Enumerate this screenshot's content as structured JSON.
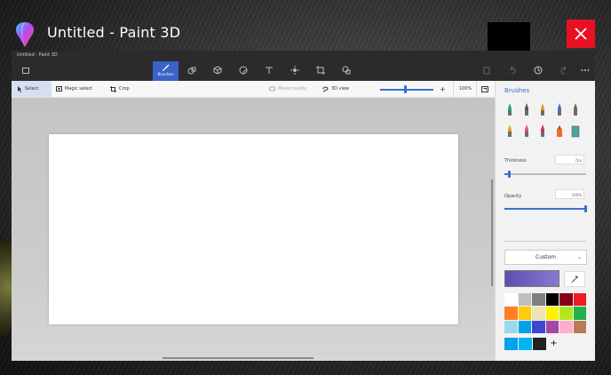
{
  "desktop": {},
  "titlebar": {
    "title": "Untitled - Paint 3D",
    "close_icon": "close-icon"
  },
  "window": {
    "inner_title": "Untitled - Paint 3D"
  },
  "menubar": {
    "active_tab_label": "Brushes",
    "icons": [
      "menu-icon",
      "brushes-icon",
      "2d-shapes-icon",
      "3d-shapes-icon",
      "stickers-icon",
      "text-icon",
      "effects-icon",
      "canvas-icon",
      "3d-library-icon",
      "paste-icon",
      "undo-icon",
      "history-icon",
      "redo-icon",
      "more-icon"
    ]
  },
  "toolbar": {
    "select": "Select",
    "magic_select": "Magic select",
    "crop": "Crop",
    "mixed_reality": "Mixed reality",
    "view_3d": "3D view",
    "zoom_level": "100%"
  },
  "panel": {
    "title": "Brushes",
    "thickness_label": "Thickness",
    "thickness_value": "7px",
    "thickness_fraction": 0.06,
    "opacity_label": "Opacity",
    "opacity_value": "100%",
    "opacity_fraction": 1.0,
    "material": "Custom",
    "current_color": "#5c4fb0",
    "brushes": [
      {
        "name": "marker",
        "color": "#1aa884"
      },
      {
        "name": "calligraphy-pen",
        "color": "#555555"
      },
      {
        "name": "oil-brush",
        "color": "#e9a01e"
      },
      {
        "name": "watercolor",
        "color": "#3b6fd1"
      },
      {
        "name": "pixel-pen",
        "color": "#666666"
      },
      {
        "name": "pencil",
        "color": "#e9a01e"
      },
      {
        "name": "eraser",
        "color": "#e94c7b"
      },
      {
        "name": "crayon",
        "color": "#c8237a"
      },
      {
        "name": "spray-can",
        "color": "#f26c23"
      },
      {
        "name": "fill",
        "color": "#4aa3a0"
      }
    ],
    "palette": [
      "#ffffff",
      "#bfbfbf",
      "#7f7f7f",
      "#000000",
      "#880015",
      "#ed1c24",
      "#ff7f27",
      "#ffc90e",
      "#efe4b0",
      "#fff200",
      "#b5e61d",
      "#22b14c",
      "#99d9ea",
      "#00a2e8",
      "#3f48cc",
      "#a349a4",
      "#ffaec9",
      "#b97a57"
    ],
    "custom_colors": [
      "#00a2e8",
      "#00b4f0",
      "#222222"
    ],
    "add_label": "+"
  }
}
